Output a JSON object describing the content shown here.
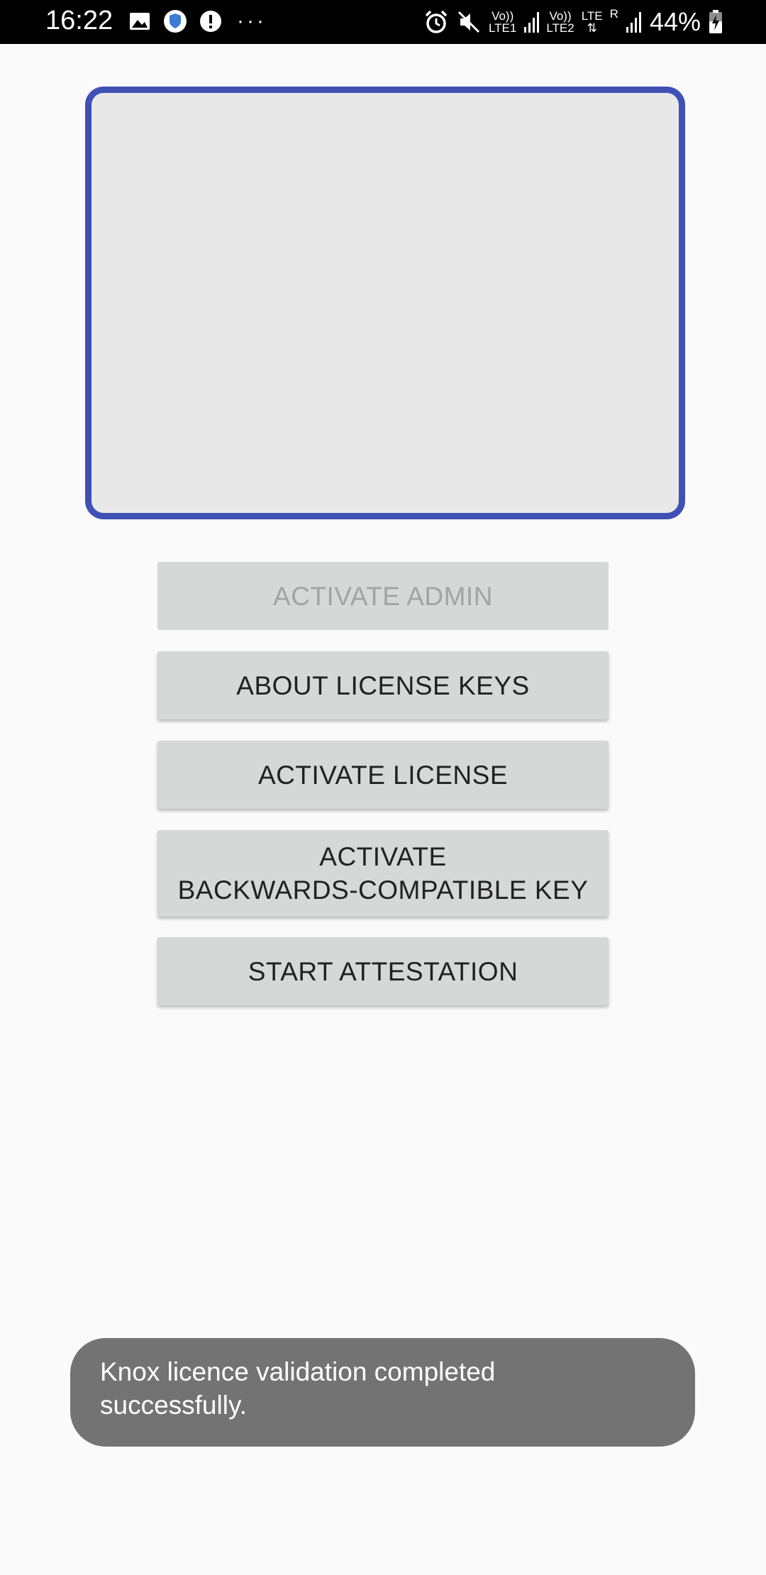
{
  "status_bar": {
    "time": "16:22",
    "left_icons": [
      "image-icon",
      "shield-app-icon",
      "alert-icon"
    ],
    "more": "···",
    "net1_top": "Vo))",
    "net1_bottom": "LTE1",
    "net2_top": "Vo))",
    "net2_bottom": "LTE2",
    "lte_label": "LTE",
    "roaming": "R",
    "battery": "44%",
    "right_icons": [
      "alarm-icon",
      "mute-icon",
      "signal-icon",
      "signal-icon",
      "battery-charging-icon"
    ]
  },
  "buttons": {
    "activate_admin": "ACTIVATE ADMIN",
    "about_license_keys": "ABOUT LICENSE KEYS",
    "activate_license": "ACTIVATE LICENSE",
    "backcompat_line1": "ACTIVATE",
    "backcompat_line2": "BACKWARDS-COMPATIBLE KEY",
    "start_attestation": "START ATTESTATION"
  },
  "toast": {
    "line1": "Knox licence validation completed",
    "line2": "successfully."
  },
  "colors": {
    "frame_border": "#3f51b5",
    "button_bg": "#d6d7d7",
    "toast_bg": "#737373",
    "background": "#fafafa"
  }
}
